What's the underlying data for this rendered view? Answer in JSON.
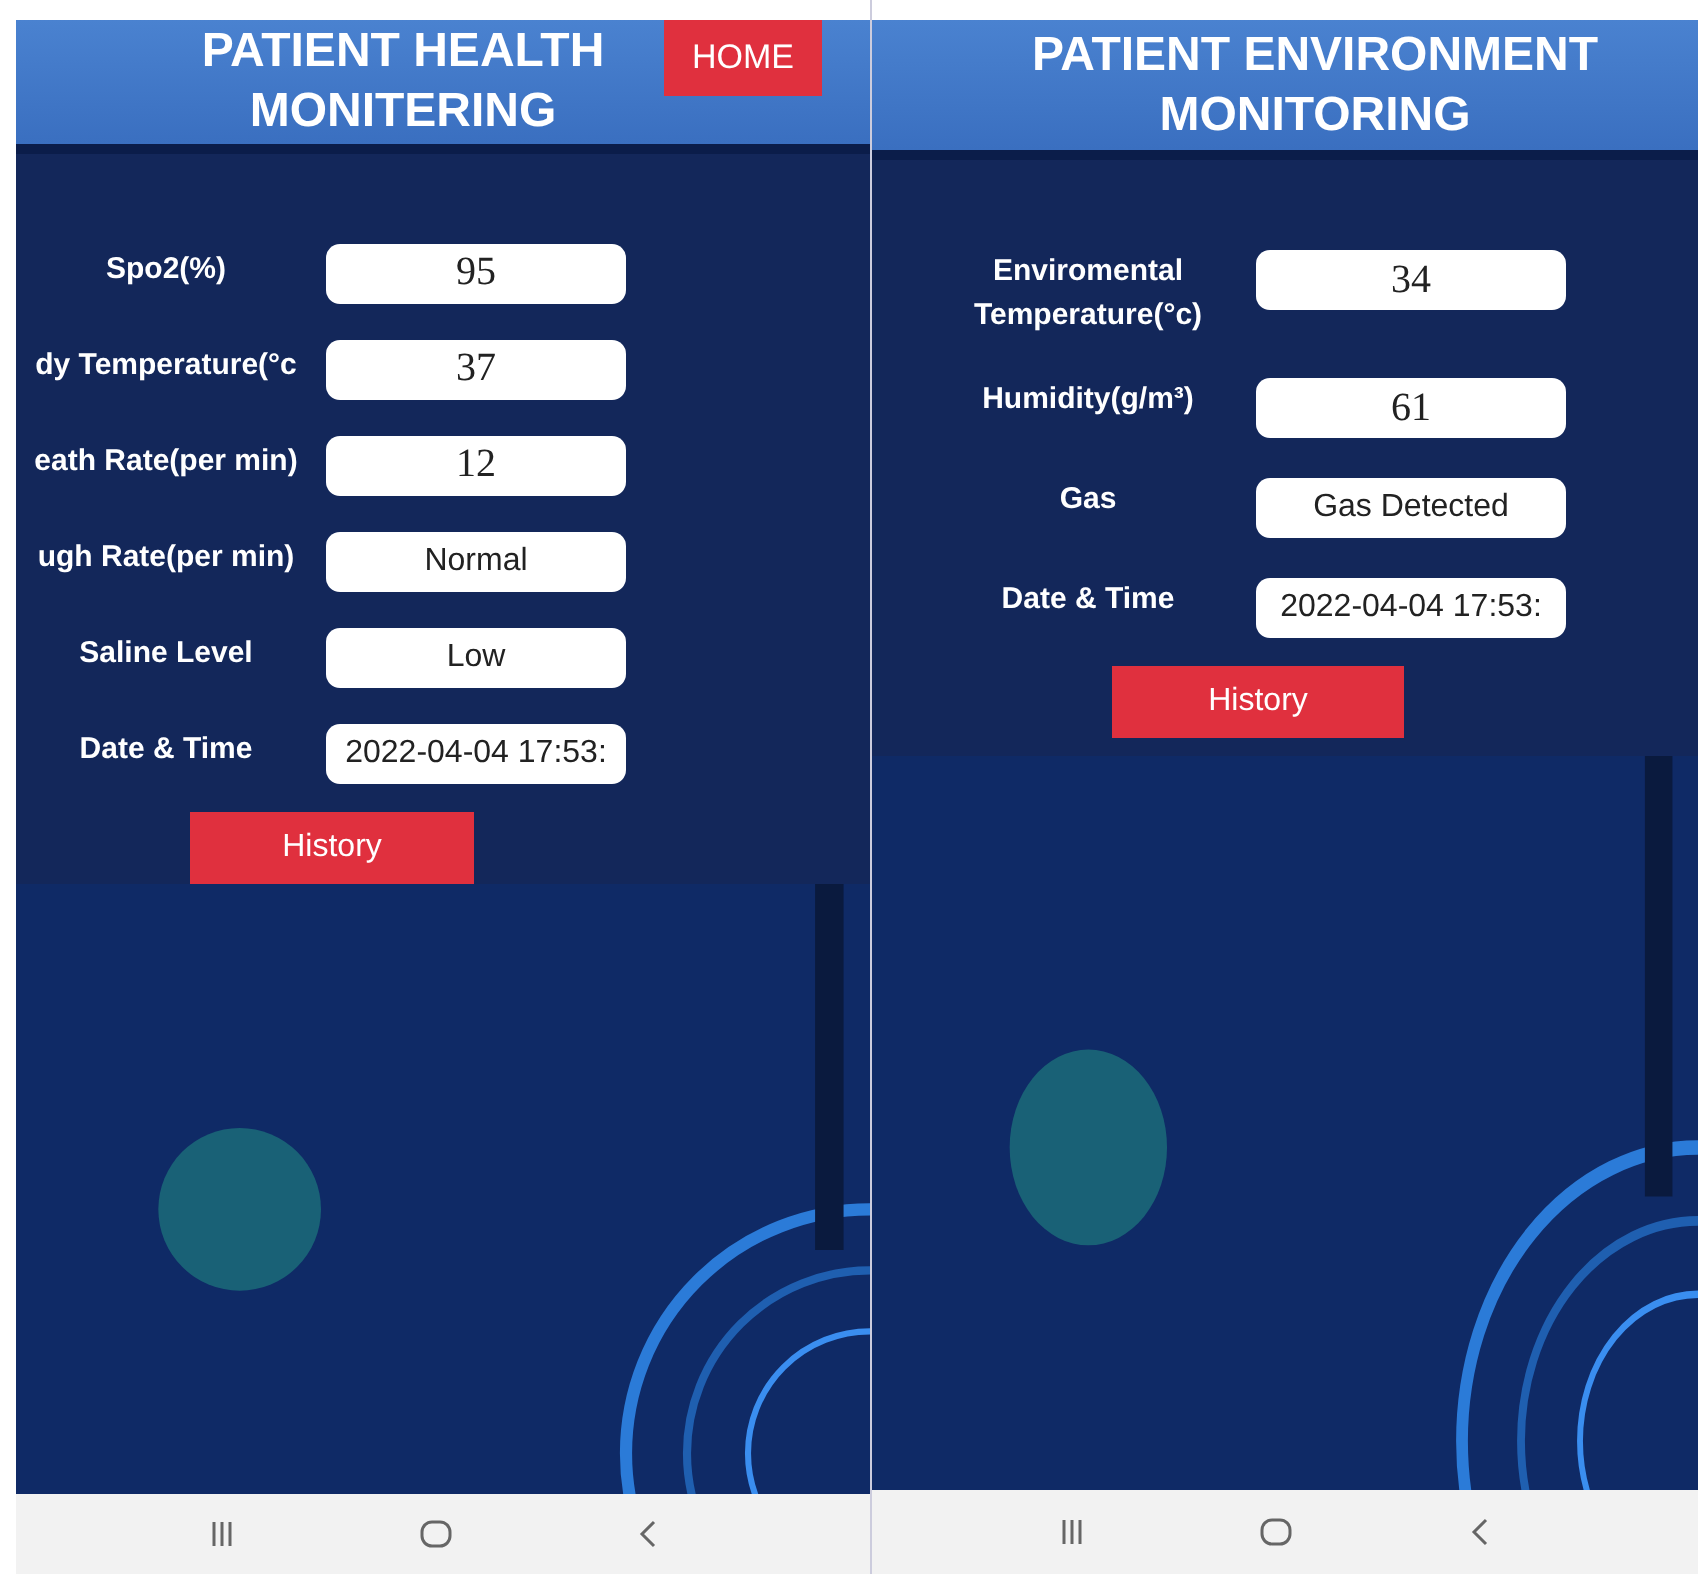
{
  "screens": [
    {
      "title": "PATIENT HEALTH MONITERING",
      "home_button": "HOME",
      "fields": [
        {
          "label": "Spo2(%)",
          "value": "95",
          "kind": "numeric"
        },
        {
          "label": "dy Temperature(°c",
          "value": "37",
          "kind": "numeric"
        },
        {
          "label": "eath Rate(per min)",
          "value": "12",
          "kind": "numeric"
        },
        {
          "label": "ugh Rate(per min)",
          "value": "Normal",
          "kind": "text"
        },
        {
          "label": "Saline Level",
          "value": "Low",
          "kind": "text"
        },
        {
          "label": "Date & Time",
          "value": "2022-04-04 17:53:",
          "kind": "text"
        }
      ],
      "history_button": "History"
    },
    {
      "title": "PATIENT ENVIRONMENT MONITORING",
      "fields": [
        {
          "label": "Enviromental Temperature(°c)",
          "value": "34",
          "kind": "numeric"
        },
        {
          "label": "Humidity(g/m³)",
          "value": "61",
          "kind": "numeric"
        },
        {
          "label": "Gas",
          "value": "Gas Detected",
          "kind": "text"
        },
        {
          "label": "Date & Time",
          "value": "2022-04-04 17:53:",
          "kind": "text"
        }
      ],
      "history_button": "History"
    }
  ]
}
